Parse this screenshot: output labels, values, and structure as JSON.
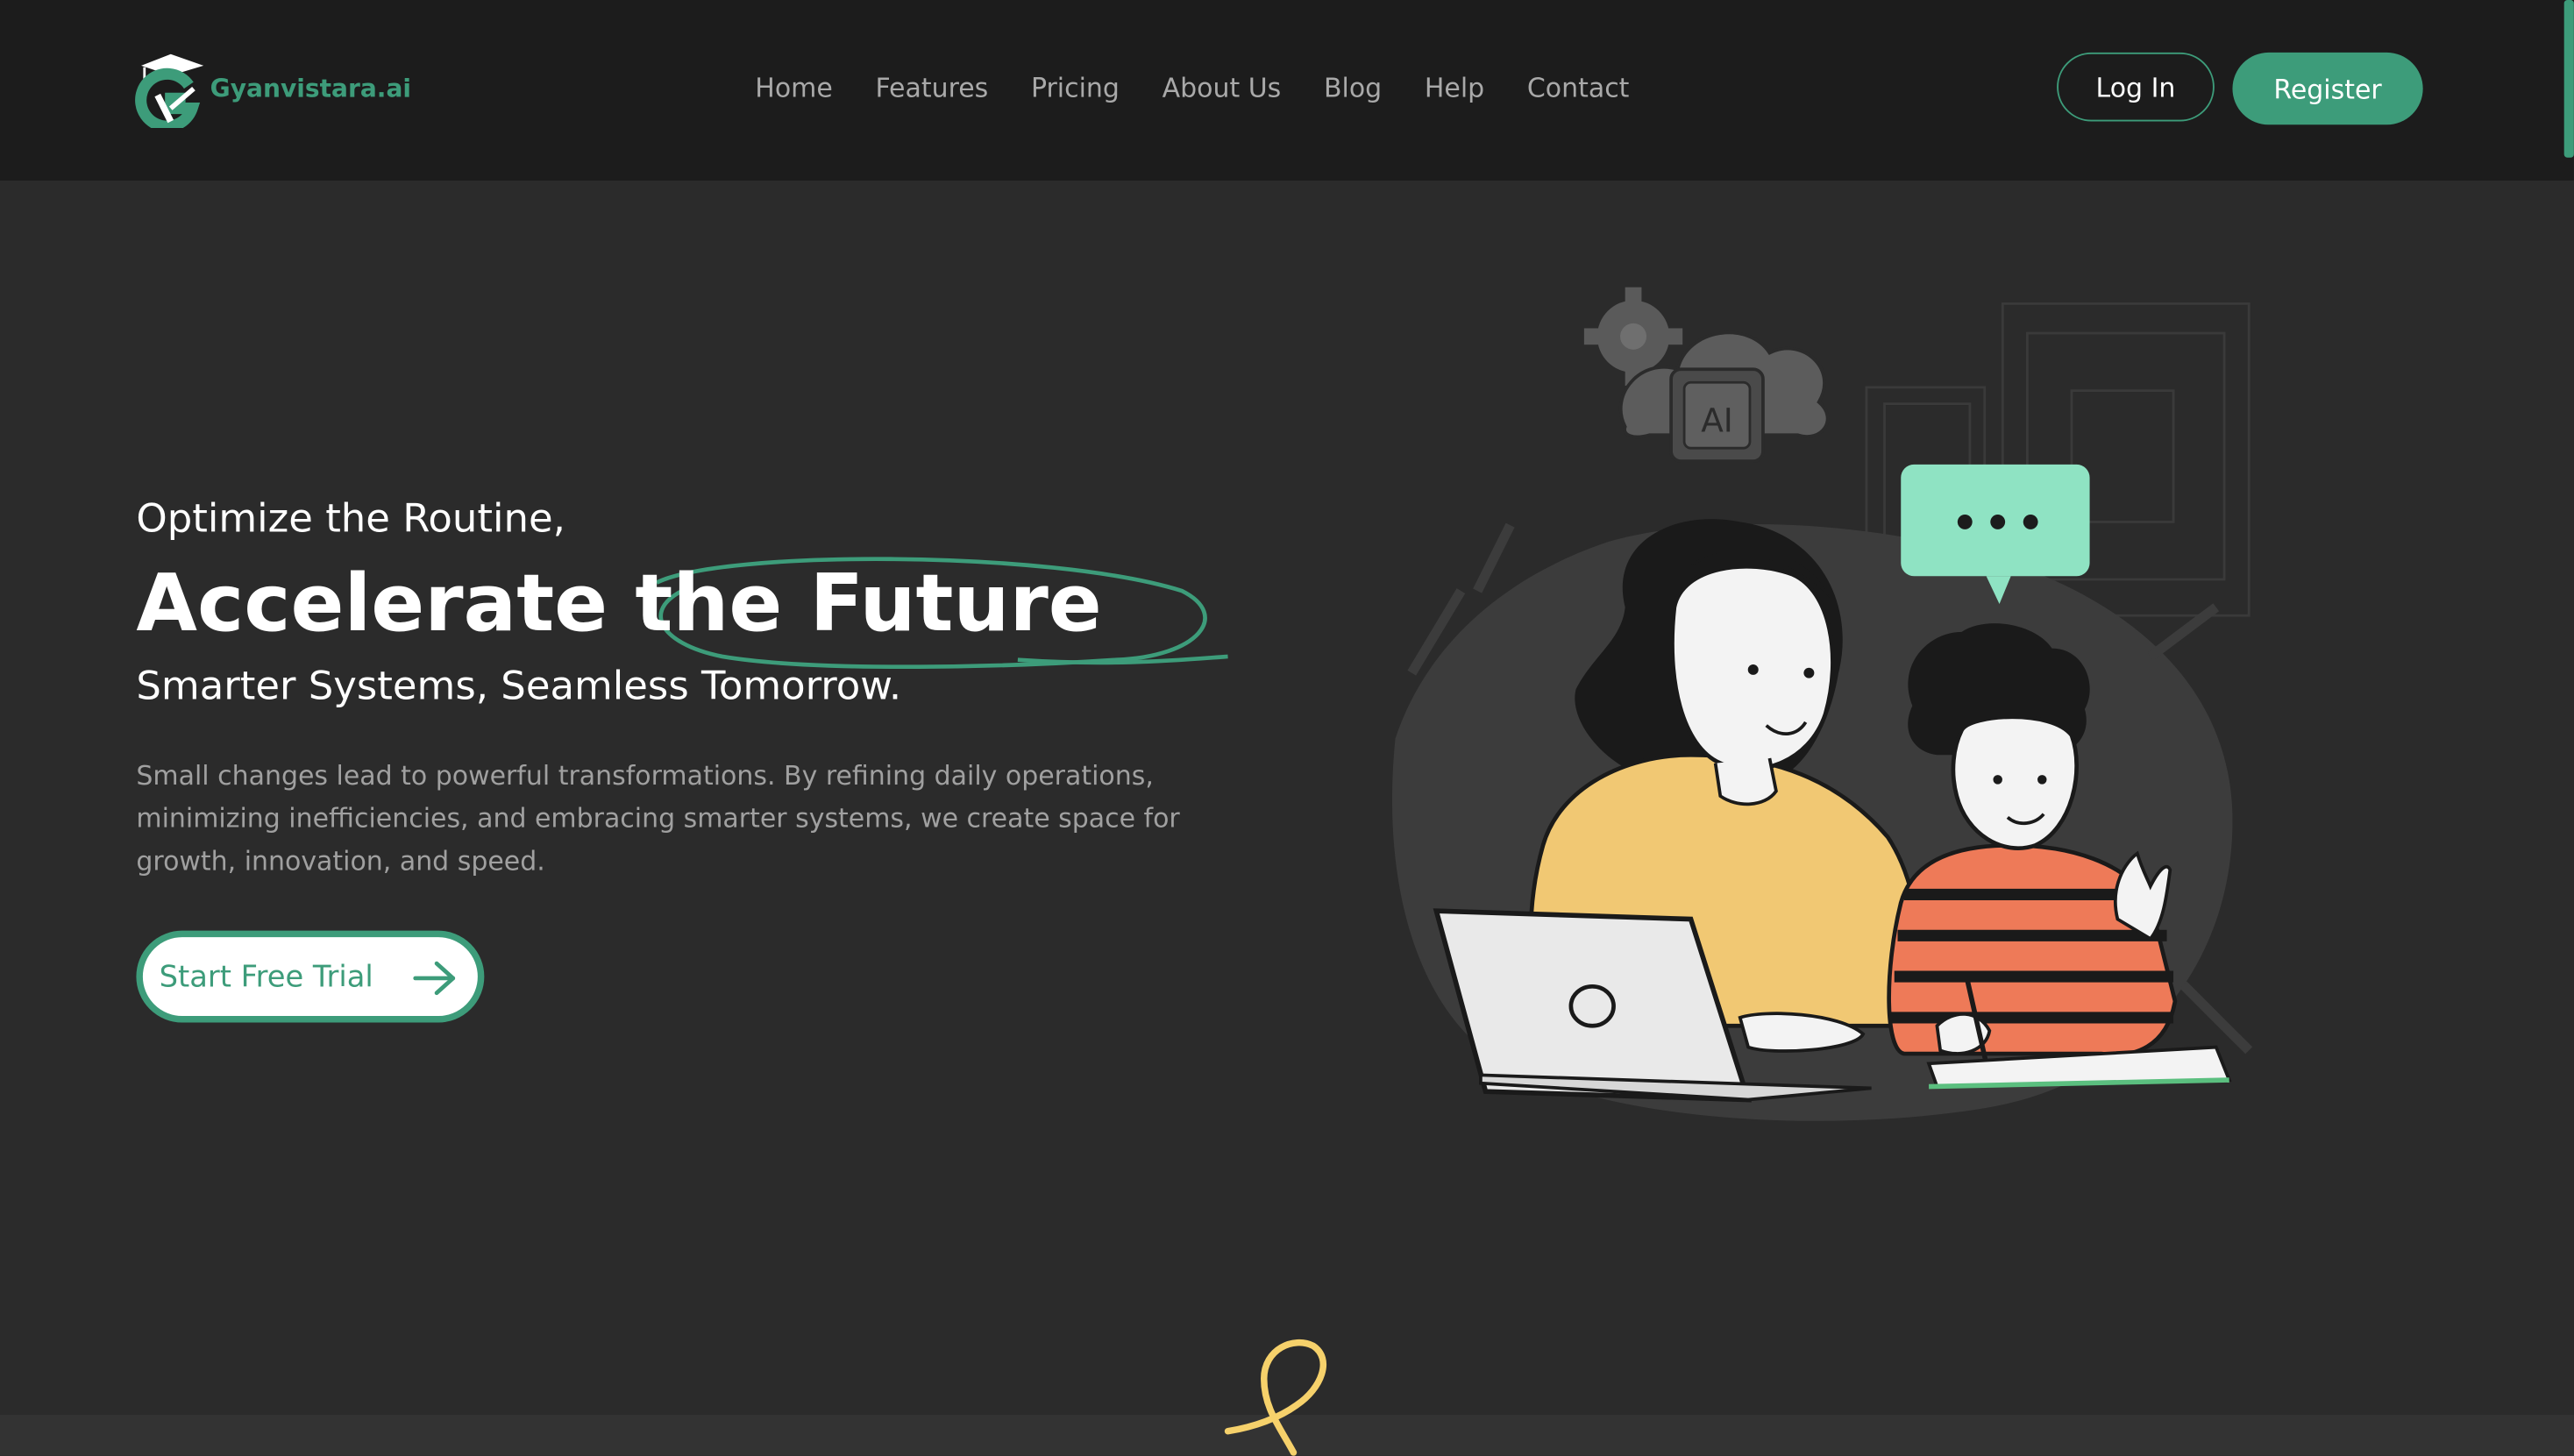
{
  "brand": {
    "name": "Gyanvistara.ai",
    "accent_color": "#3d9c7a"
  },
  "nav": {
    "items": [
      {
        "label": "Home"
      },
      {
        "label": "Features"
      },
      {
        "label": "Pricing"
      },
      {
        "label": "About Us"
      },
      {
        "label": "Blog"
      },
      {
        "label": "Help"
      },
      {
        "label": "Contact"
      }
    ]
  },
  "auth": {
    "login_label": "Log In",
    "register_label": "Register"
  },
  "hero": {
    "kicker": "Optimize the Routine,",
    "title": "Accelerate the Future",
    "subtitle": "Smarter Systems, Seamless Tomorrow.",
    "description": "Small changes lead to powerful transformations. By refining daily operations, minimizing inefficiencies, and embracing smarter systems, we create space for growth, innovation, and speed.",
    "cta_label": "Start Free Trial",
    "cta_icon": "arrow-right-icon"
  },
  "illustration": {
    "chip_text": "AI",
    "icons": [
      "gear-icon",
      "cloud-icon",
      "chat-bubble-icon",
      "laptop-icon"
    ]
  },
  "colors": {
    "header_bg": "#1c1c1c",
    "page_bg": "#2b2b2b",
    "bubble": "#8fe3c3",
    "sweater": "#f1c873",
    "stripes": "#ee7a58",
    "squiggle": "#f6d16b"
  }
}
